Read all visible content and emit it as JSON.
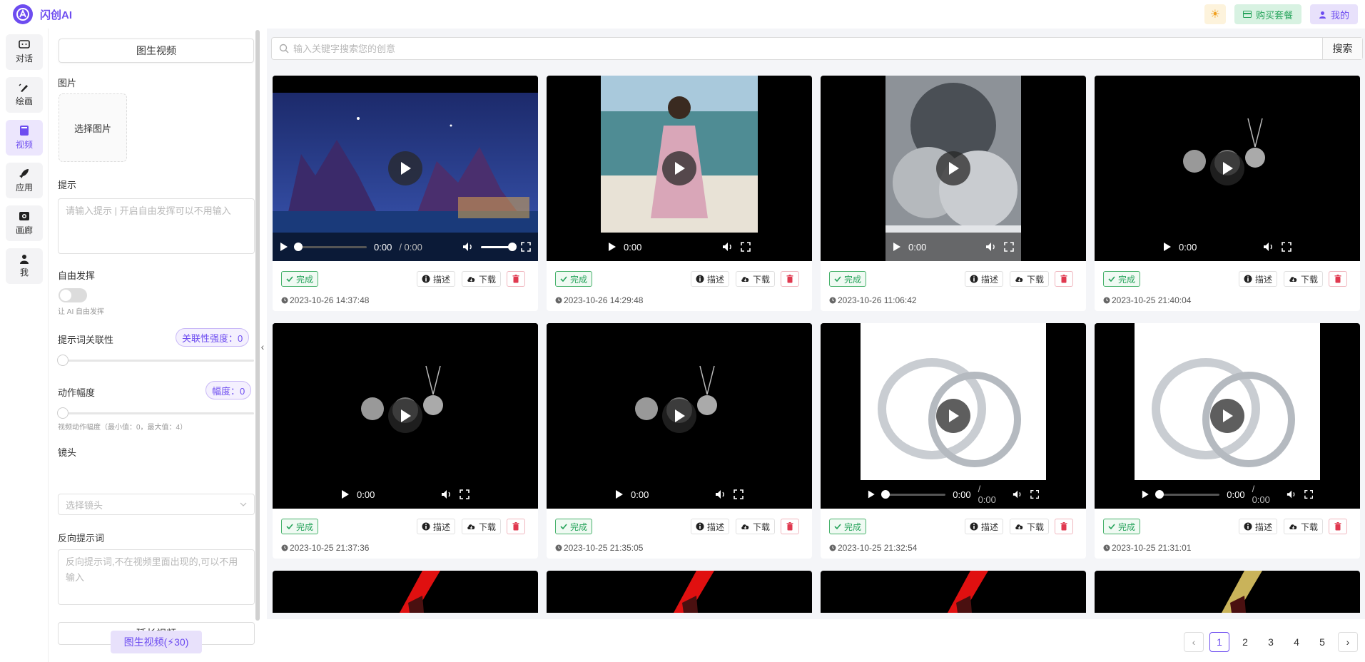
{
  "app": {
    "name": "闪创AI"
  },
  "header": {
    "buy_label": "购买套餐",
    "me_label": "我的"
  },
  "nav": [
    {
      "label": "对话",
      "icon": "chat-icon"
    },
    {
      "label": "绘画",
      "icon": "brush-icon"
    },
    {
      "label": "视频",
      "icon": "video-icon",
      "active": true
    },
    {
      "label": "应用",
      "icon": "rocket-icon"
    },
    {
      "label": "画廊",
      "icon": "gallery-icon"
    },
    {
      "label": "我",
      "icon": "user-icon"
    }
  ],
  "panel": {
    "tab_label": "图生视频",
    "image_label": "图片",
    "choose_image": "选择图片",
    "prompt_label": "提示",
    "prompt_placeholder": "请输入提示 | 开启自由发挥可以不用输入",
    "free_label": "自由发挥",
    "free_hint": "让 AI 自由发挥",
    "relevance_label": "提示词关联性",
    "relevance_pill": "关联性强度：0",
    "motion_label": "动作幅度",
    "motion_pill": "幅度：0",
    "motion_hint": "视频动作幅度（最小值：0，最大值：4）",
    "lens_label": "镜头",
    "lens_placeholder": "选择镜头",
    "negative_label": "反向提示词",
    "negative_placeholder": "反向提示词,不在视频里面出现的,可以不用输入",
    "extend_label": "延长视频",
    "submit_label": "图生视频(⚡30)"
  },
  "search": {
    "placeholder": "输入关键字搜索您的创意",
    "button": "搜索"
  },
  "card_labels": {
    "done": "完成",
    "describe": "描述",
    "download": "下载"
  },
  "cards": [
    {
      "time": "2023-10-26 14:37:48",
      "ctrl_time": "0:00",
      "ctrl_total": "0:00",
      "thumb": "castle"
    },
    {
      "time": "2023-10-26 14:29:48",
      "ctrl_time": "0:00",
      "thumb": "beach"
    },
    {
      "time": "2023-10-26 11:06:42",
      "ctrl_time": "0:00",
      "thumb": "smoke"
    },
    {
      "time": "2023-10-25 21:40:04",
      "ctrl_time": "0:00",
      "thumb": "necklace"
    },
    {
      "time": "2023-10-25 21:37:36",
      "ctrl_time": "0:00",
      "thumb": "necklace"
    },
    {
      "time": "2023-10-25 21:35:05",
      "ctrl_time": "0:00",
      "thumb": "necklace"
    },
    {
      "time": "2023-10-25 21:32:54",
      "ctrl_time": "0:00",
      "ctrl_total": "0:00",
      "thumb": "rings"
    },
    {
      "time": "2023-10-25 21:31:01",
      "ctrl_time": "0:00",
      "ctrl_total": "0:00",
      "thumb": "rings"
    }
  ],
  "pagination": {
    "pages": [
      "1",
      "2",
      "3",
      "4",
      "5"
    ],
    "current": "1"
  },
  "colors": {
    "accent": "#6d4cf0",
    "success": "#25a35a",
    "danger": "#e0384f"
  }
}
